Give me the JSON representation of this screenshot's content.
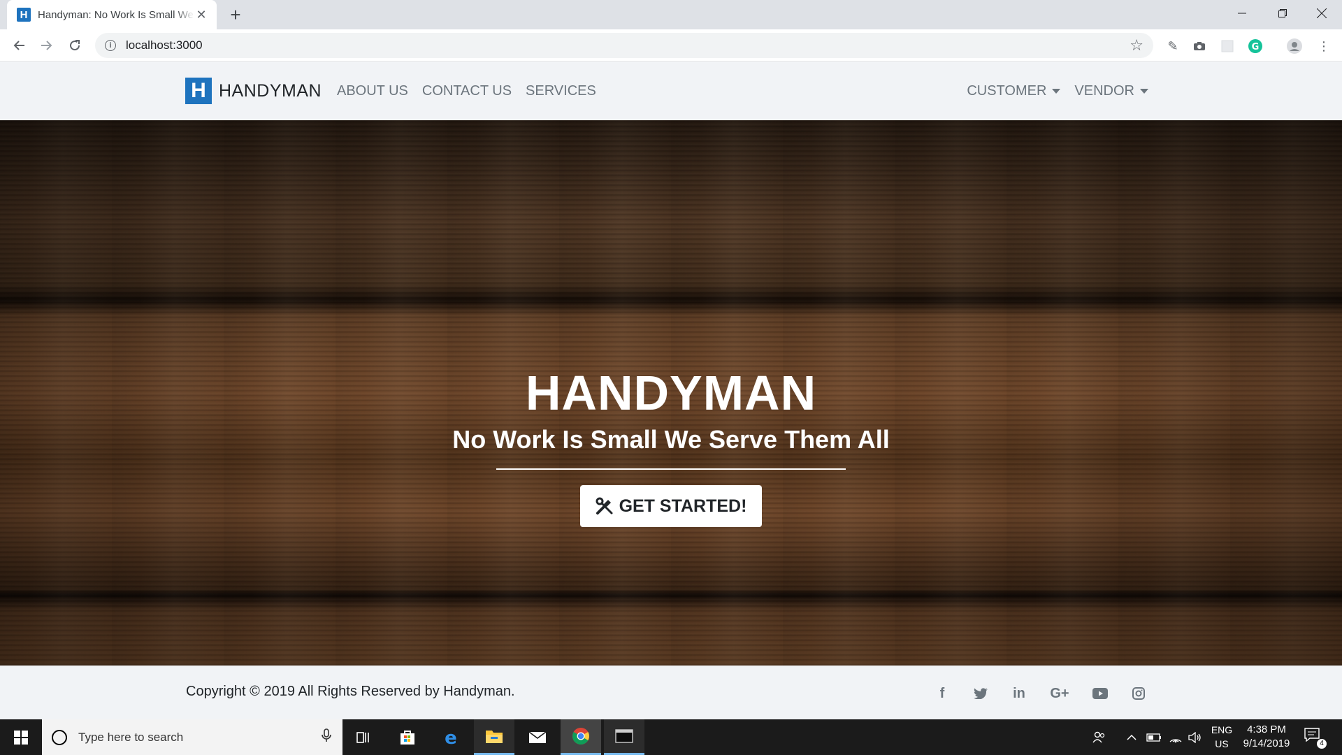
{
  "browser": {
    "tab_title": "Handyman: No Work Is Small We Serve Them All",
    "favicon_letter": "H",
    "url": "localhost:3000"
  },
  "site": {
    "brand": {
      "logo_letter": "H",
      "name": "HANDYMAN"
    },
    "nav_links": [
      "ABOUT US",
      "CONTACT US",
      "SERVICES"
    ],
    "dropdowns": [
      "CUSTOMER",
      "VENDOR"
    ],
    "hero": {
      "title": "HANDYMAN",
      "subtitle": "No Work Is Small We Serve Them All",
      "cta_label": "GET STARTED!"
    },
    "footer": {
      "copyright": "Copyright © 2019 All Rights Reserved by Handyman.",
      "socials": [
        "facebook",
        "twitter",
        "linkedin",
        "google-plus",
        "youtube",
        "instagram"
      ]
    },
    "colors": {
      "brand_blue": "#1e73be",
      "nav_bg": "#f1f3f6",
      "nav_text": "#6c757d"
    }
  },
  "taskbar": {
    "search_placeholder": "Type here to search",
    "lang_line1": "ENG",
    "lang_line2": "US",
    "time": "4:38 PM",
    "date": "9/14/2019",
    "notification_count": "4"
  }
}
